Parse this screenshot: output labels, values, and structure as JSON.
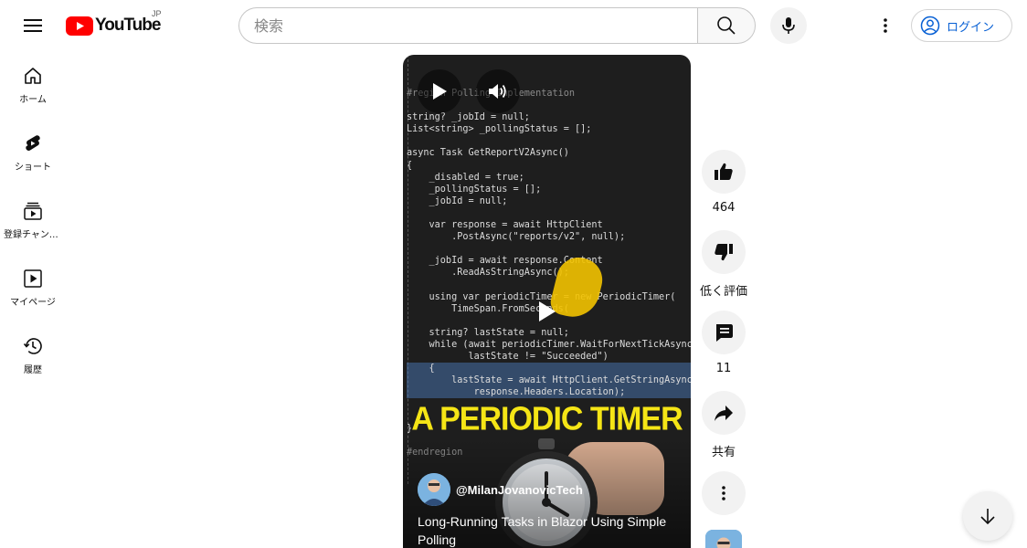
{
  "header": {
    "logo_text": "YouTube",
    "region": "JP",
    "search_placeholder": "検索",
    "login_label": "ログイン"
  },
  "sidebar": {
    "items": [
      {
        "label": "ホーム",
        "icon": "home-icon"
      },
      {
        "label": "ショート",
        "icon": "shorts-icon"
      },
      {
        "label": "登録チャンネル",
        "icon": "subscriptions-icon"
      },
      {
        "label": "マイページ",
        "icon": "you-icon"
      },
      {
        "label": "履歴",
        "icon": "history-icon"
      }
    ]
  },
  "video": {
    "channel": "@MilanJovanovicTech",
    "title": "Long-Running Tasks in Blazor Using Simple Polling",
    "banner": "A PERIODIC TIMER",
    "code_lines": [
      "#region Polling Implementation",
      "",
      "string? _jobId = null;",
      "List<string> _pollingStatus = [];",
      "",
      "async Task GetReportV2Async()",
      "{",
      "    _disabled = true;",
      "    _pollingStatus = [];",
      "    _jobId = null;",
      "",
      "    var response = await HttpClient",
      "        .PostAsync(\"reports/v2\", null);",
      "",
      "    _jobId = await response.Content",
      "        .ReadAsStringAsync();",
      "",
      "    using var periodicTimer = new PeriodicTimer(",
      "        TimeSpan.FromSeconds(",
      "",
      "    string? lastState = null;",
      "    while (await periodicTimer.WaitForNextTickAsync()",
      "           lastState != \"Succeeded\")",
      "    {",
      "        lastState = await HttpClient.GetStringAsync(",
      "            response.Headers.Location);",
      "",
      "",
      "}",
      "",
      "#endregion"
    ]
  },
  "actions": {
    "like_count": "464",
    "dislike_label": "低く評価",
    "comment_count": "11",
    "share_label": "共有"
  },
  "colors": {
    "brand_red": "#ff0000",
    "link_blue": "#065fd4",
    "banner_yellow": "#f5e516"
  }
}
